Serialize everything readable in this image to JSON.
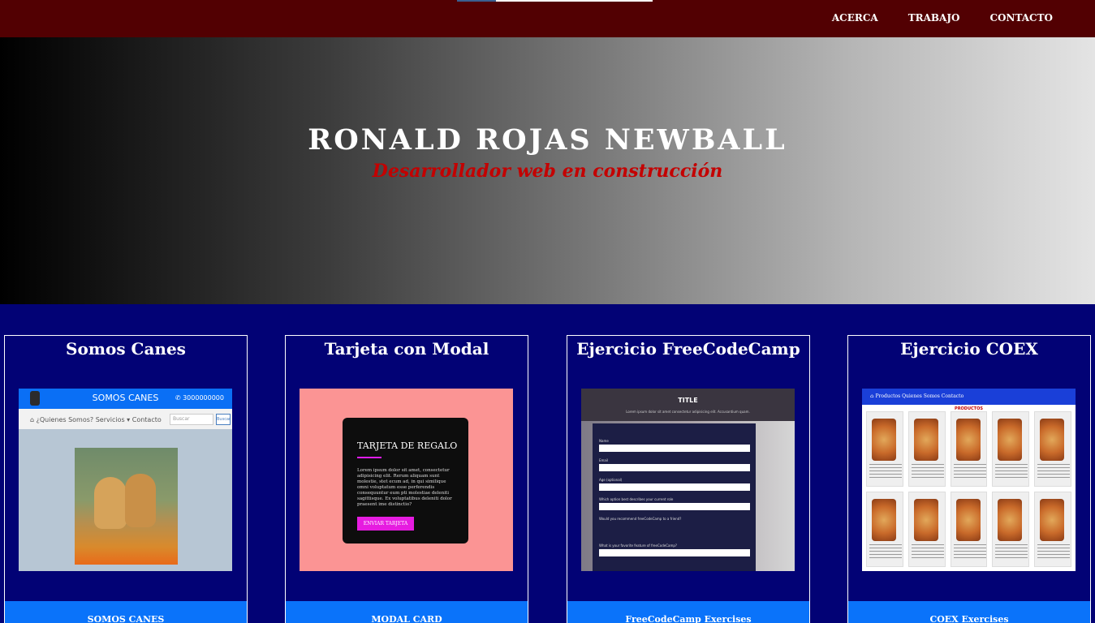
{
  "nav": {
    "links": [
      "ACERCA",
      "TRABAJO",
      "CONTACTO"
    ]
  },
  "hero": {
    "title": "RONALD ROJAS NEWBALL",
    "subtitle": "Desarrollador web en construcción"
  },
  "projects": [
    {
      "title": "Somos Canes",
      "button": "SOMOS CANES",
      "thumb": {
        "brand": "SOMOS CANES",
        "phone": "✆ 3000000000",
        "menu": "⌂  ¿Quienes Somos?   Servicios ▾   Contacto",
        "search_placeholder": "Buscar",
        "search_button": "Buscar"
      }
    },
    {
      "title": "Tarjeta con Modal",
      "button": "MODAL CARD",
      "thumb": {
        "card_title": "TARJETA DE REGALO",
        "card_text": "Lorem ipsum dolor sit amet, consectetur adipisicing elit. Rerum aliquam sunt molestie, stet ecum ad, in qui similique omni voluptatum esse perferendis consequuntur eum pti molestiae deleniti sagittisque. Ex voluptatibus deleniti dolor praesent ime distinctio?",
        "card_button": "ENVIAR TARJETA"
      }
    },
    {
      "title": "Ejercicio FreeCodeCamp",
      "button": "FreeCodeCamp Exercises",
      "thumb": {
        "title": "TITLE",
        "subtitle": "Lorem ipsum dolor sit amet consectetur adipisicing elit. Accusantium quam.",
        "labels": [
          "Name",
          "Email",
          "Age (optional)",
          "Which option best describes your current role",
          "Would you recommend freeCodeCamp to a friend?",
          "What is your favorite feature of freeCodeCamp?"
        ]
      }
    },
    {
      "title": "Ejercicio COEX",
      "button": "COEX Exercises",
      "thumb": {
        "menu": "⌂   Productos    Quienes Somos    Contacto",
        "heading": "PRODUCTOS"
      }
    }
  ]
}
